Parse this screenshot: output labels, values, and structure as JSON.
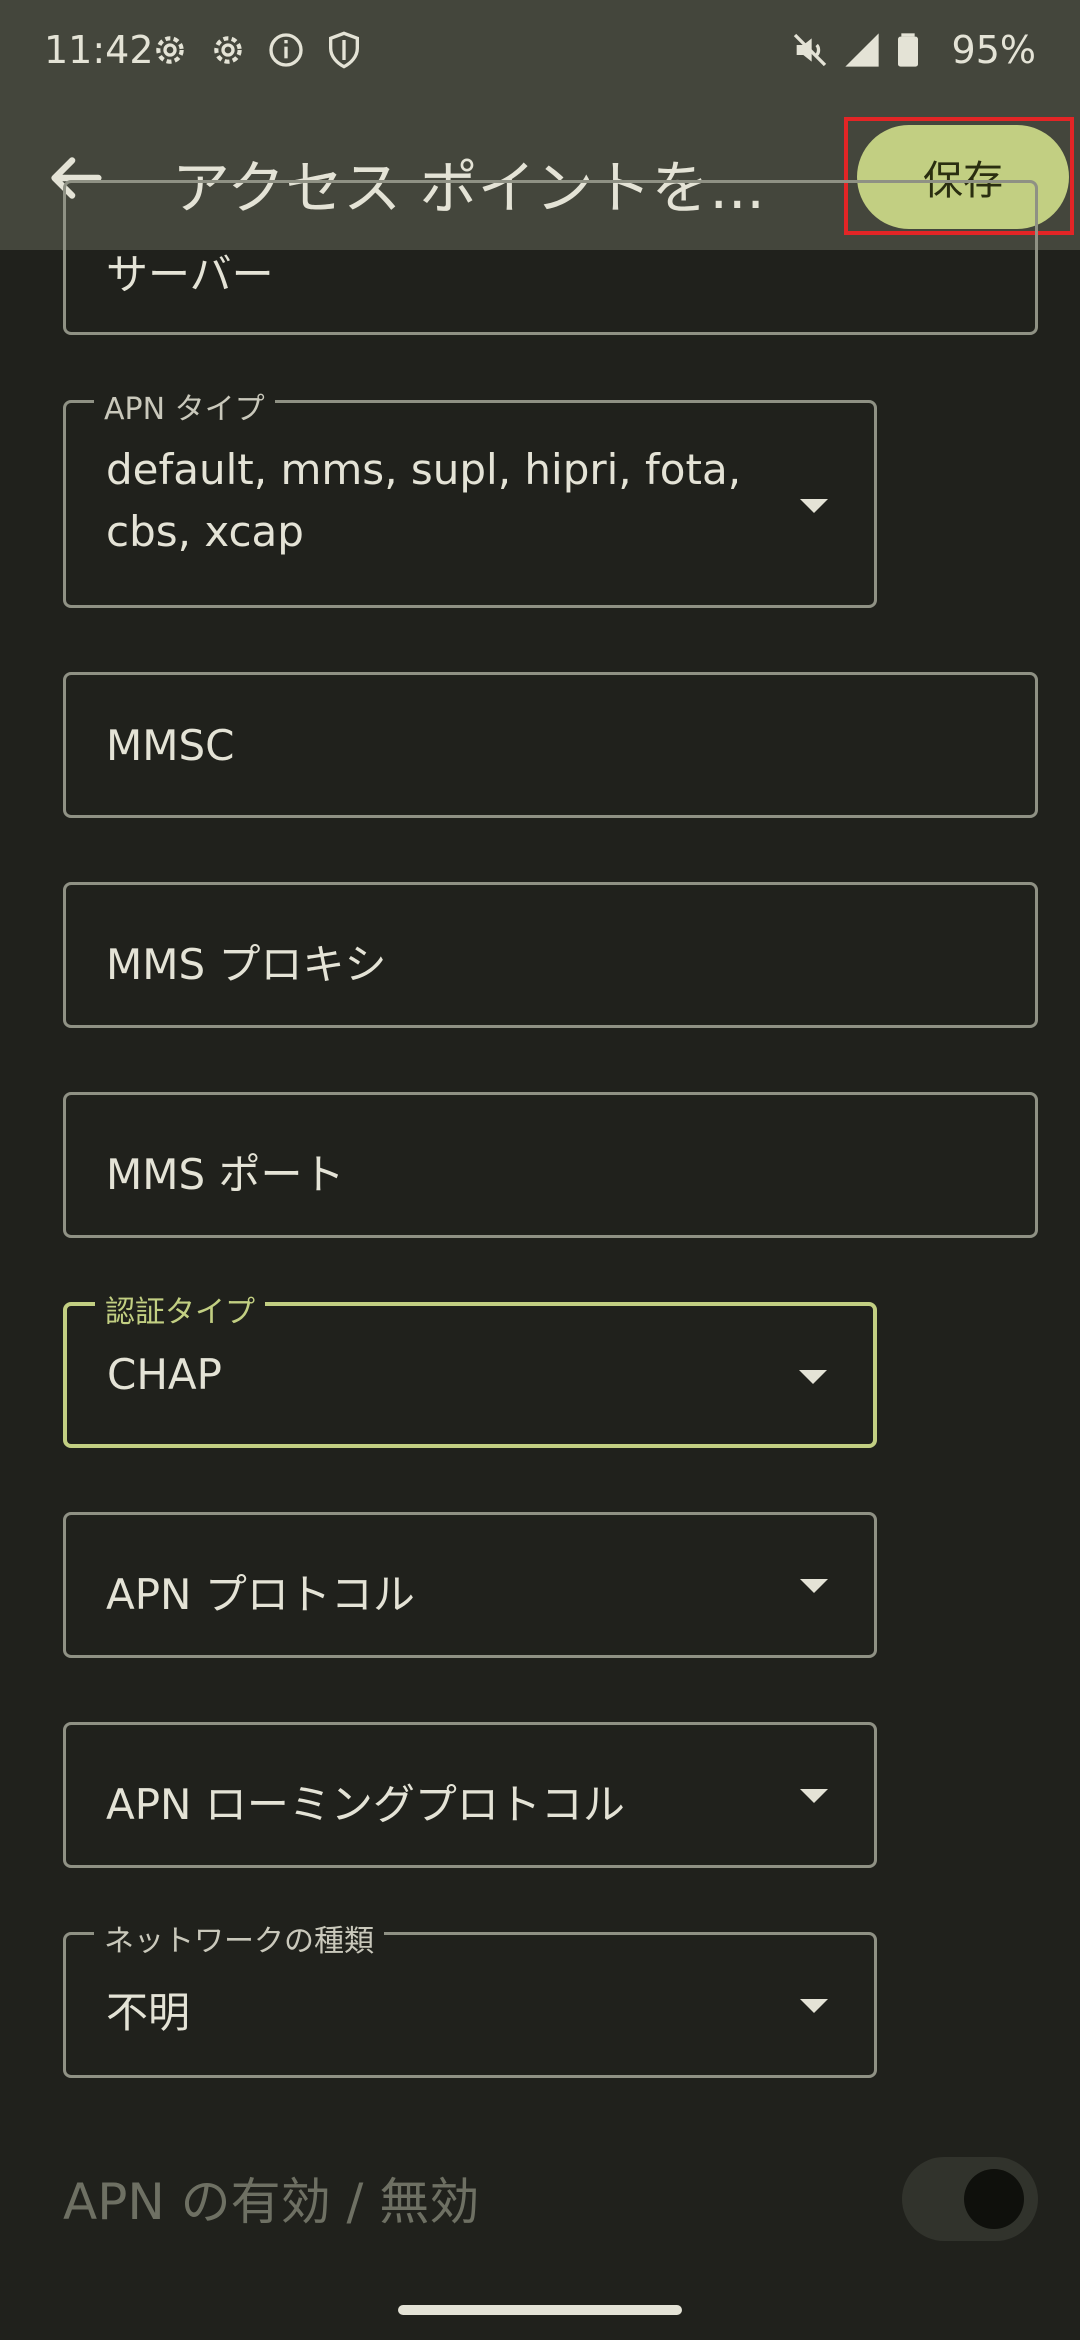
{
  "status_bar": {
    "time": "11:42",
    "icons": [
      "gear-icon",
      "gear-icon",
      "info-icon",
      "shield-icon"
    ],
    "right_icons": [
      "mute-icon",
      "signal-icon",
      "battery-icon"
    ],
    "battery": "95%"
  },
  "app_bar": {
    "back_icon": "arrow-back-icon",
    "title": "アクセス ポイントを...",
    "save_label": "保存"
  },
  "fields": {
    "server": {
      "value": "サーバー"
    },
    "apn_type": {
      "label": "APN タイプ",
      "value_line1": "default, mms, supl, hipri, fota,",
      "value_line2": "cbs, xcap"
    },
    "mmsc": {
      "placeholder": "MMSC"
    },
    "mms_proxy": {
      "placeholder": "MMS プロキシ"
    },
    "mms_port": {
      "placeholder": "MMS ポート"
    },
    "auth_type": {
      "label": "認証タイプ",
      "value": "CHAP"
    },
    "apn_protocol": {
      "placeholder": "APN プロトコル"
    },
    "apn_roaming_protocol": {
      "placeholder": "APN ローミングプロトコル"
    },
    "network_type": {
      "label": "ネットワークの種類",
      "value": "不明"
    }
  },
  "apn_toggle": {
    "label": "APN の有効 / 無効",
    "state": "disabled"
  },
  "colors": {
    "accent": "#c2cf82",
    "background": "#20211c",
    "app_bar": "#44463c",
    "highlight": "#e32526"
  }
}
